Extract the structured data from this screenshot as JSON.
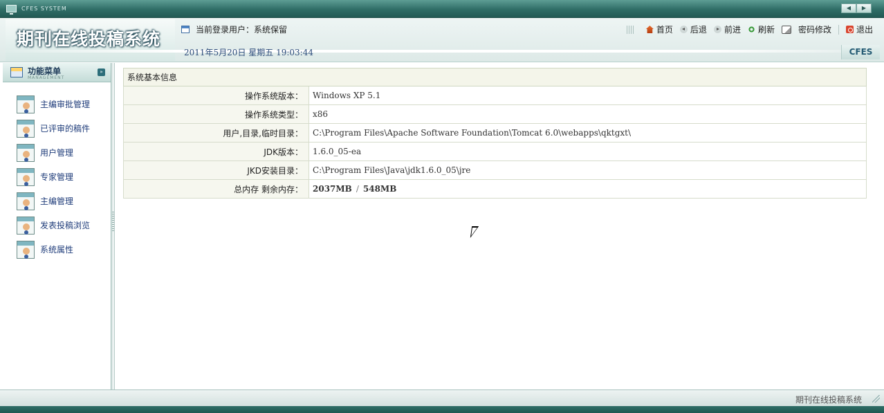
{
  "window": {
    "system_label": "CFES SYSTEM",
    "prev_arrow": "◀",
    "next_arrow": "▶"
  },
  "header": {
    "logo_title": "期刊在线投稿系统",
    "current_user": "当前登录用户：系统保留",
    "date_line": "2011年5月20日  星期五  19:03:44",
    "brand": "CFES",
    "nav": {
      "home": "首页",
      "back": "后退",
      "forward": "前进",
      "refresh": "刷新",
      "change_password": "密码修改",
      "logout": "退出"
    }
  },
  "sidebar": {
    "title": "功能菜单",
    "subtitle": "MANAGEMENT",
    "collapse_glyph": "»",
    "items": [
      {
        "label": "主编审批管理"
      },
      {
        "label": "已评审的稿件"
      },
      {
        "label": "用户管理"
      },
      {
        "label": "专家管理"
      },
      {
        "label": "主编管理"
      },
      {
        "label": "发表投稿浏览"
      },
      {
        "label": "系统属性"
      }
    ]
  },
  "main": {
    "table_title": "系统基本信息",
    "rows": [
      {
        "key": "操作系统版本：",
        "value": "Windows XP  5.1"
      },
      {
        "key": "操作系统类型：",
        "value": "x86"
      },
      {
        "key": "用户,目录,临时目录：",
        "value": "C:\\Program Files\\Apache Software Foundation\\Tomcat 6.0\\webapps\\qktgxt\\"
      },
      {
        "key": "JDK版本：",
        "value": "1.6.0_05-ea"
      },
      {
        "key": "JKD安装目录：",
        "value": "C:\\Program Files\\Java\\jdk1.6.0_05\\jre"
      }
    ],
    "memory": {
      "key": "总内存 剩余内存：",
      "total": "2037MB",
      "separator": "/",
      "free": "548MB"
    }
  },
  "footer": {
    "text": "期刊在线投稿系统"
  }
}
